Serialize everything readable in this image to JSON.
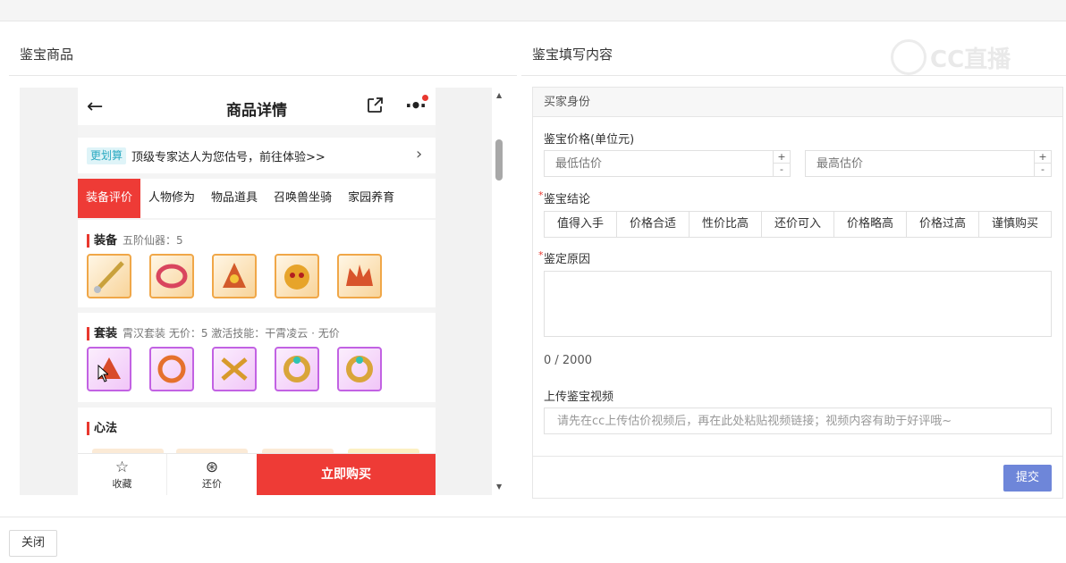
{
  "left_title": "鉴宝商品",
  "right_title": "鉴宝填写内容",
  "watermark_text": "CC直播",
  "phone": {
    "title": "商品详情",
    "banner_tag": "更划算",
    "banner_text": "顶级专家达人为您估号，前往体验>>",
    "tabs": [
      "装备评价",
      "人物修为",
      "物品道具",
      "召唤兽坐骑",
      "家园养育"
    ],
    "active_tab": "装备评价",
    "equipment": {
      "title": "装备",
      "sub": "五阶仙器：5"
    },
    "set": {
      "title": "套装",
      "sub": "霄汉套装   无价：5   激活技能：干霄凌云 · 无价"
    },
    "xinfa": {
      "title": "心法"
    },
    "bottom": {
      "fav": "收藏",
      "bargain": "还价",
      "buy": "立即购买"
    }
  },
  "form": {
    "section": "买家身份",
    "price_label": "鉴宝价格(单位元)",
    "min_placeholder": "最低估价",
    "max_placeholder": "最高估价",
    "conclusion_label": "鉴宝结论",
    "conclusions": [
      "值得入手",
      "价格合适",
      "性价比高",
      "还价可入",
      "价格略高",
      "价格过高",
      "谨慎购买"
    ],
    "reason_label": "鉴定原因",
    "char_count": "0 / 2000",
    "video_label": "上传鉴宝视频",
    "video_placeholder": "请先在cc上传估价视频后，再在此处粘贴视频链接；视频内容有助于好评哦~",
    "submit": "提交"
  },
  "close": "关闭",
  "colors": {
    "accent_red": "#ee3b36",
    "submit_blue": "#6e86d9",
    "orange_frame": "#f0a748",
    "purple_frame": "#c262e3"
  }
}
